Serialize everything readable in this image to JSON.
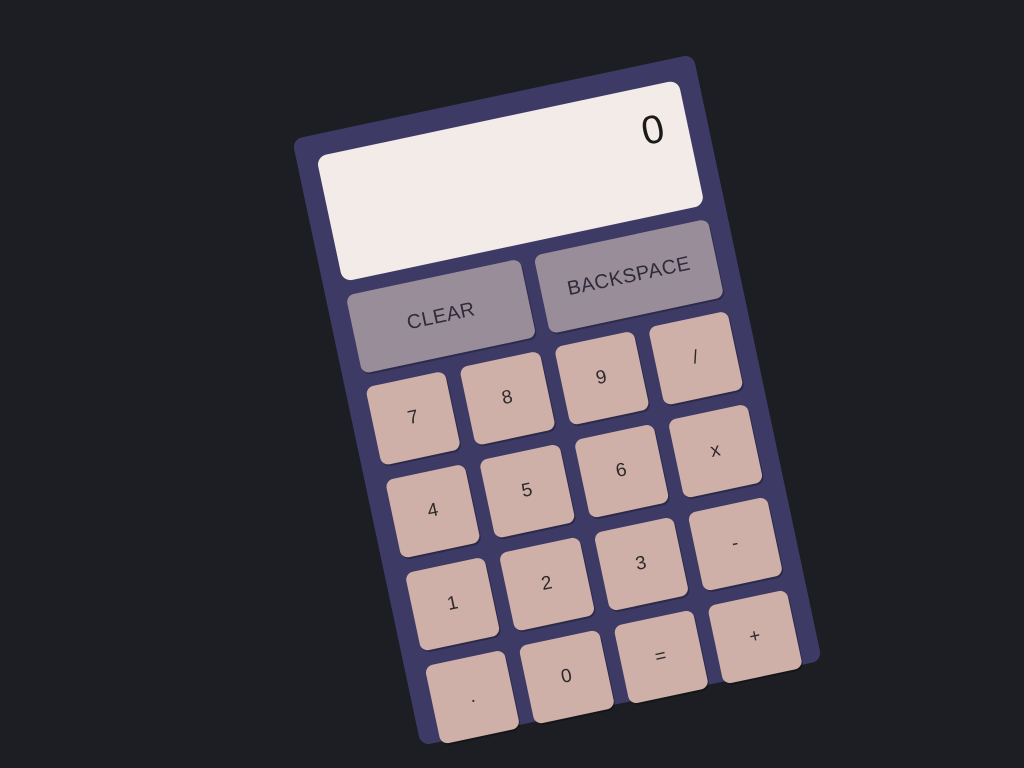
{
  "display": {
    "value": "0"
  },
  "actions": {
    "clear": "CLEAR",
    "backspace": "BACKSPACE"
  },
  "keys": [
    "7",
    "8",
    "9",
    "/",
    "4",
    "5",
    "6",
    "x",
    "1",
    "2",
    "3",
    "-",
    ".",
    "0",
    "=",
    "+"
  ],
  "colors": {
    "background": "#1c1e23",
    "body": "#3d3a66",
    "display": "#f3ebe7",
    "action_button": "#9a8d9a",
    "key": "#cfb0a8"
  }
}
